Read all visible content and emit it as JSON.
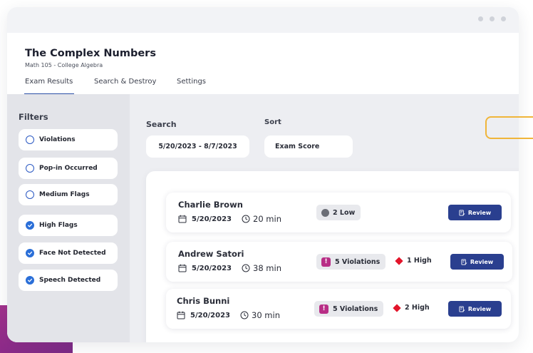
{
  "header": {
    "title": "The Complex Numbers",
    "subtitle": "Math 105 - College Algebra"
  },
  "tabs": [
    {
      "label": "Exam Results",
      "active": true
    },
    {
      "label": "Search & Destroy",
      "active": false
    },
    {
      "label": "Settings",
      "active": false
    }
  ],
  "filters": {
    "title": "Filters",
    "items": [
      {
        "label": "Violations",
        "checked": false
      },
      {
        "label": "Pop-in Occurred",
        "checked": false
      },
      {
        "label": "Medium Flags",
        "checked": false
      },
      {
        "label": "High Flags",
        "checked": true
      },
      {
        "label": "Face Not Detected",
        "checked": true
      },
      {
        "label": "Speech Detected",
        "checked": true
      }
    ]
  },
  "search": {
    "label": "Search",
    "date_range": "5/20/2023 - 8/7/2023"
  },
  "sort": {
    "label": "Sort",
    "value": "Exam Score"
  },
  "results": [
    {
      "name": "Charlie Brown",
      "date": "5/20/2023",
      "duration": "20 min",
      "badge": "2 Low",
      "badge_type": "low",
      "high": "",
      "action": "Review"
    },
    {
      "name": "Andrew Satori",
      "date": "5/20/2023",
      "duration": "38 min",
      "badge": "5 Violations",
      "badge_type": "violation",
      "high": "1 High",
      "action": "Review"
    },
    {
      "name": "Chris Bunni",
      "date": "5/20/2023",
      "duration": "30 min",
      "badge": "5 Violations",
      "badge_type": "violation",
      "high": "2 High",
      "action": "Review"
    }
  ],
  "icons": {
    "violation_glyph": "!"
  },
  "colors": {
    "accent": "#2a3f8f",
    "violation": "#b82e86",
    "high_flag": "#e3152b",
    "checkbox": "#2b6fd8",
    "decoration_purple": "#a2328c",
    "decoration_orange": "#f0b53a"
  }
}
